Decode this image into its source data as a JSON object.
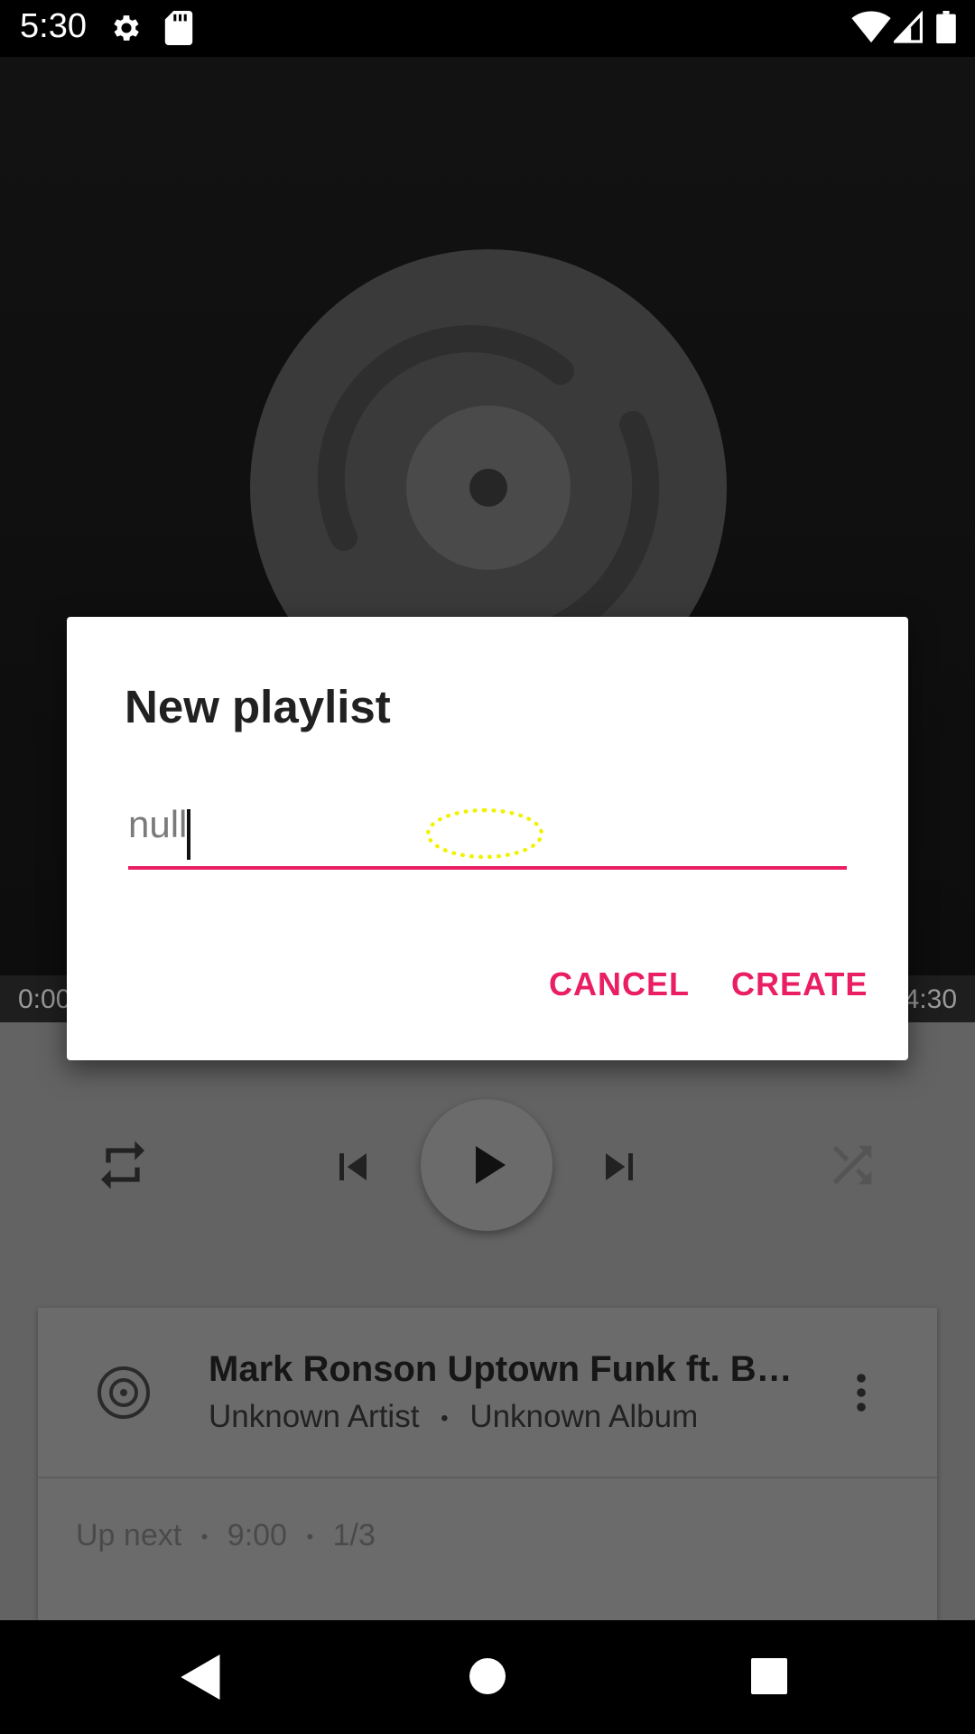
{
  "status_bar": {
    "time": "5:30",
    "icons": [
      "settings-icon",
      "sd-card-icon",
      "wifi-icon",
      "signal-icon",
      "battery-icon"
    ]
  },
  "player": {
    "elapsed": "0:00",
    "duration": "4:30",
    "controls": [
      "repeat-icon",
      "previous-icon",
      "play-icon",
      "next-icon",
      "shuffle-icon"
    ]
  },
  "now_playing": {
    "title": "Mark Ronson  Uptown Funk ft. B…",
    "artist": "Unknown Artist",
    "album": "Unknown Album",
    "separator": "•"
  },
  "queue": {
    "label": "Up next",
    "time": "9:00",
    "position": "1/3"
  },
  "dialog": {
    "title": "New playlist",
    "input_value": "null",
    "cancel_label": "CANCEL",
    "create_label": "CREATE"
  },
  "colors": {
    "accent": "#e91e63",
    "focus_ring": "#f2f200"
  },
  "nav_bar": [
    "back-icon",
    "home-icon",
    "recents-icon"
  ]
}
